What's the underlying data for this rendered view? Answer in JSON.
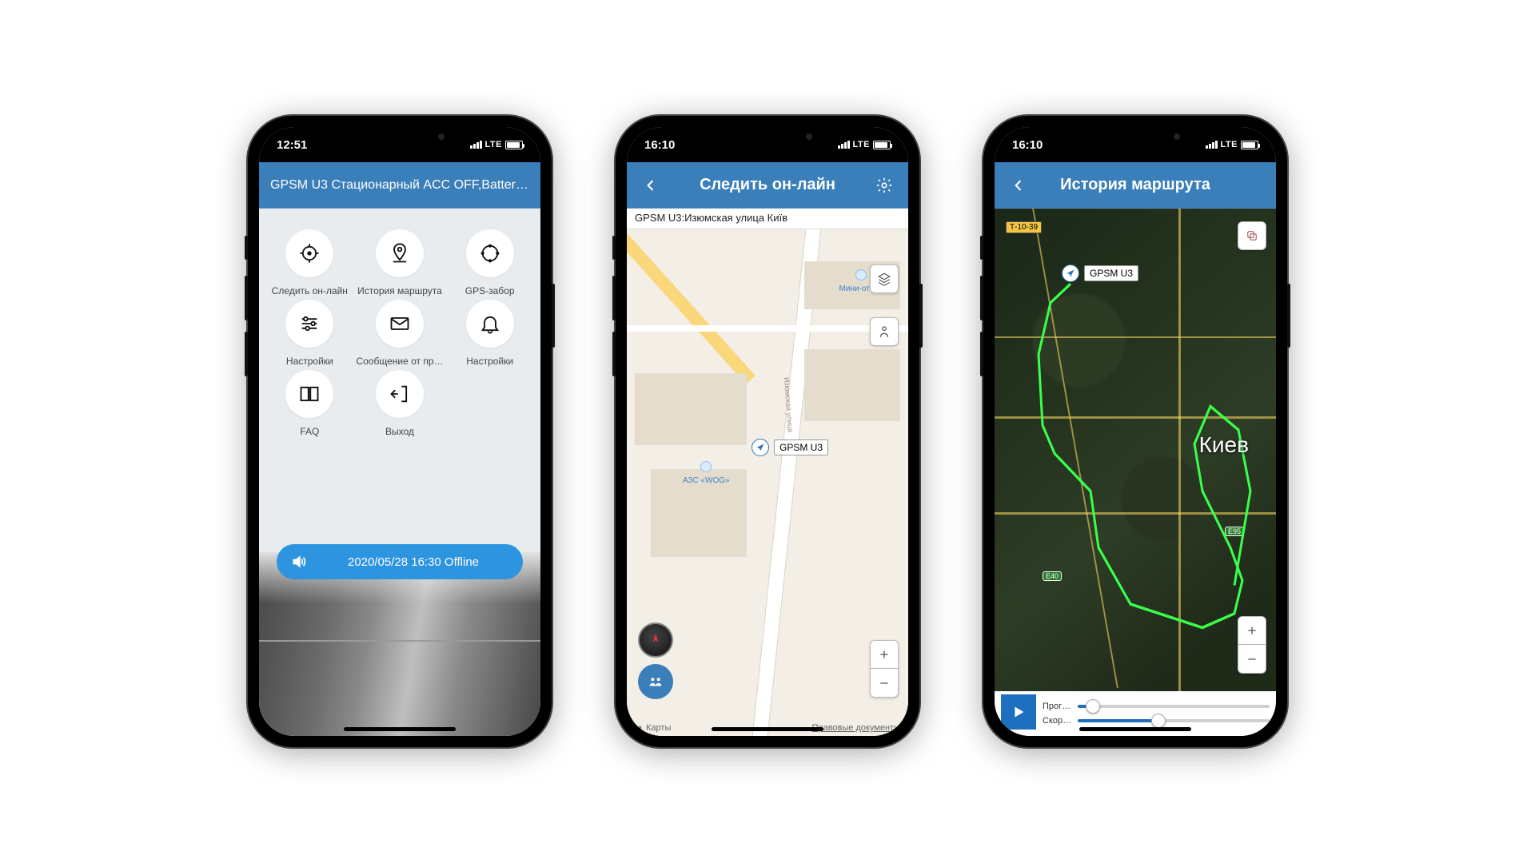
{
  "status_bar": {
    "time_p1": "12:51",
    "time_p2": "16:10",
    "time_p3": "16:10",
    "network": "LTE"
  },
  "phone1": {
    "header": "GPSM U3 Стационарный ACC OFF,Battery1…",
    "items": [
      {
        "label": "Следить он-лайн"
      },
      {
        "label": "История маршрута"
      },
      {
        "label": "GPS-забор"
      },
      {
        "label": "Настройки"
      },
      {
        "label": "Сообщение от пр…"
      },
      {
        "label": "Настройки"
      },
      {
        "label": "FAQ"
      },
      {
        "label": "Выход"
      }
    ],
    "status_text": "2020/05/28 16:30 Offline"
  },
  "phone2": {
    "title": "Следить он-лайн",
    "address": "GPSM U3:Изюмская улица Київ",
    "marker_label": "GPSM U3",
    "poi_hotel": "Мини-отель",
    "poi_gas": "АЗС «WOG»",
    "street_label": "Изюмская улица",
    "map_brand": "Карты",
    "legal": "Правовые документы"
  },
  "phone3": {
    "title": "История маршрута",
    "marker_label": "GPSM U3",
    "city": "Киев",
    "road_badge": "Т-10-39",
    "hwy1": "E95",
    "hwy2": "E40",
    "slider_progress_label": "Прог…",
    "slider_speed_label": "Скор…",
    "progress_pct": 8,
    "speed_pct": 42
  },
  "colors": {
    "brand_blue": "#3a7fb9",
    "accent_blue": "#2d94e0",
    "route_green": "#38ff4b"
  }
}
